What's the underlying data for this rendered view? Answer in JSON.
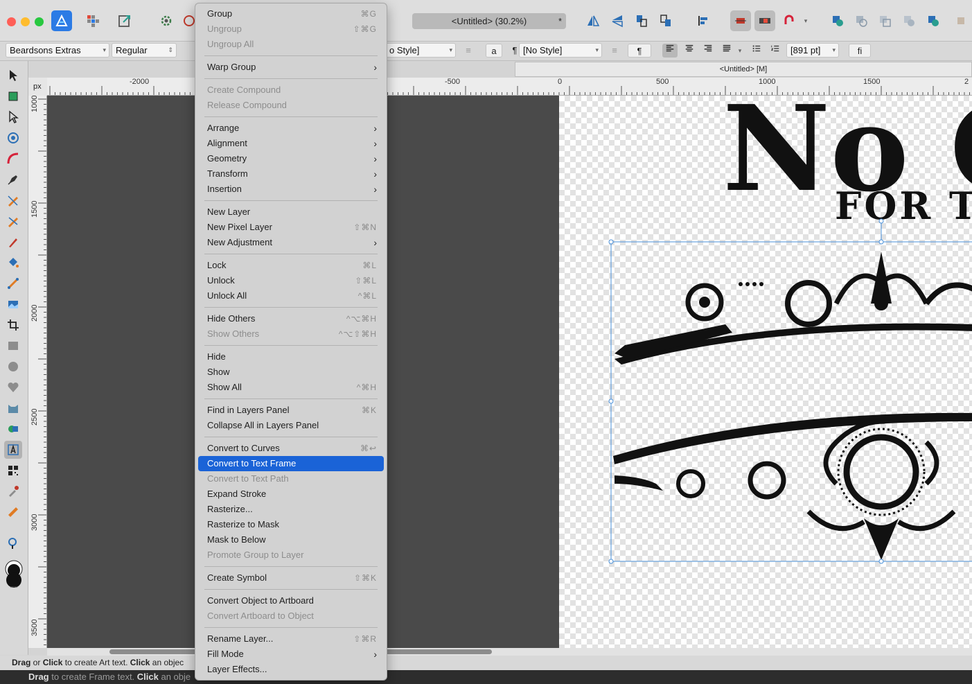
{
  "colors": {
    "accent": "#1a63d7",
    "canvas_dark": "#4a4a4a",
    "menu_bg": "#d2d2d2",
    "selection": "#4a90d9"
  },
  "titlebar": {
    "document_title": "<Untitled> (30.2%)",
    "modified_marker": "*"
  },
  "context_toolbar": {
    "font_family": "Beardsons Extras",
    "font_style": "Regular",
    "char_style": "o Style]",
    "char_label": "a",
    "para_mark": "¶",
    "para_style": "[No Style]",
    "para_button": "¶",
    "size_value": "[891 pt]",
    "ligature": "fi"
  },
  "document_tab": {
    "label": "<Untitled> [M]"
  },
  "ruler": {
    "unit": "px",
    "h_labels": [
      "-2000",
      "-500",
      "0",
      "500",
      "1000",
      "1500",
      "2"
    ],
    "v_labels": [
      "1000",
      "1500",
      "2000",
      "2500",
      "3000",
      "3500"
    ]
  },
  "artwork": {
    "headline": "No C",
    "subline": "FOR TH"
  },
  "context_menu": {
    "items": [
      {
        "label": "Group",
        "shortcut": "⌘G",
        "disabled": false
      },
      {
        "label": "Ungroup",
        "shortcut": "⇧⌘G",
        "disabled": true
      },
      {
        "label": "Ungroup All",
        "shortcut": "",
        "disabled": true
      },
      {
        "label": "Warp Group",
        "submenu": true
      },
      {
        "label": "Create Compound",
        "disabled": true
      },
      {
        "label": "Release Compound",
        "disabled": true
      },
      {
        "label": "Arrange",
        "submenu": true
      },
      {
        "label": "Alignment",
        "submenu": true
      },
      {
        "label": "Geometry",
        "submenu": true
      },
      {
        "label": "Transform",
        "submenu": true
      },
      {
        "label": "Insertion",
        "submenu": true
      },
      {
        "label": "New Layer",
        "shortcut": ""
      },
      {
        "label": "New Pixel Layer",
        "shortcut": "⇧⌘N"
      },
      {
        "label": "New Adjustment",
        "submenu": true
      },
      {
        "label": "Lock",
        "shortcut": "⌘L"
      },
      {
        "label": "Unlock",
        "shortcut": "⇧⌘L"
      },
      {
        "label": "Unlock All",
        "shortcut": "^⌘L"
      },
      {
        "label": "Hide Others",
        "shortcut": "^⌥⌘H"
      },
      {
        "label": "Show Others",
        "shortcut": "^⌥⇧⌘H",
        "disabled": true
      },
      {
        "label": "Hide",
        "shortcut": ""
      },
      {
        "label": "Show",
        "shortcut": ""
      },
      {
        "label": "Show All",
        "shortcut": "^⌘H"
      },
      {
        "label": "Find in Layers Panel",
        "shortcut": "⌘K"
      },
      {
        "label": "Collapse All in Layers Panel",
        "shortcut": ""
      },
      {
        "label": "Convert to Curves",
        "shortcut": "⌘↩"
      },
      {
        "label": "Convert to Text Frame",
        "highlighted": true
      },
      {
        "label": "Convert to Text Path",
        "disabled": true
      },
      {
        "label": "Expand Stroke"
      },
      {
        "label": "Rasterize..."
      },
      {
        "label": "Rasterize to Mask"
      },
      {
        "label": "Mask to Below"
      },
      {
        "label": "Promote Group to Layer",
        "disabled": true
      },
      {
        "label": "Create Symbol",
        "shortcut": "⇧⌘K"
      },
      {
        "label": "Convert Object to Artboard"
      },
      {
        "label": "Convert Artboard to Object",
        "disabled": true
      },
      {
        "label": "Rename Layer...",
        "shortcut": "⇧⌘R"
      },
      {
        "label": "Fill Mode",
        "submenu": true
      },
      {
        "label": "Layer Effects..."
      }
    ]
  },
  "status": {
    "line1": {
      "drag": "Drag",
      "or": " or ",
      "click": "Click",
      "rest1": " to create Art text. ",
      "click2": "Click",
      "rest2": " an objec"
    },
    "line2": {
      "drag": "Drag",
      "rest1": " to create Frame text. ",
      "click": "Click",
      "rest2": " an obje"
    }
  }
}
